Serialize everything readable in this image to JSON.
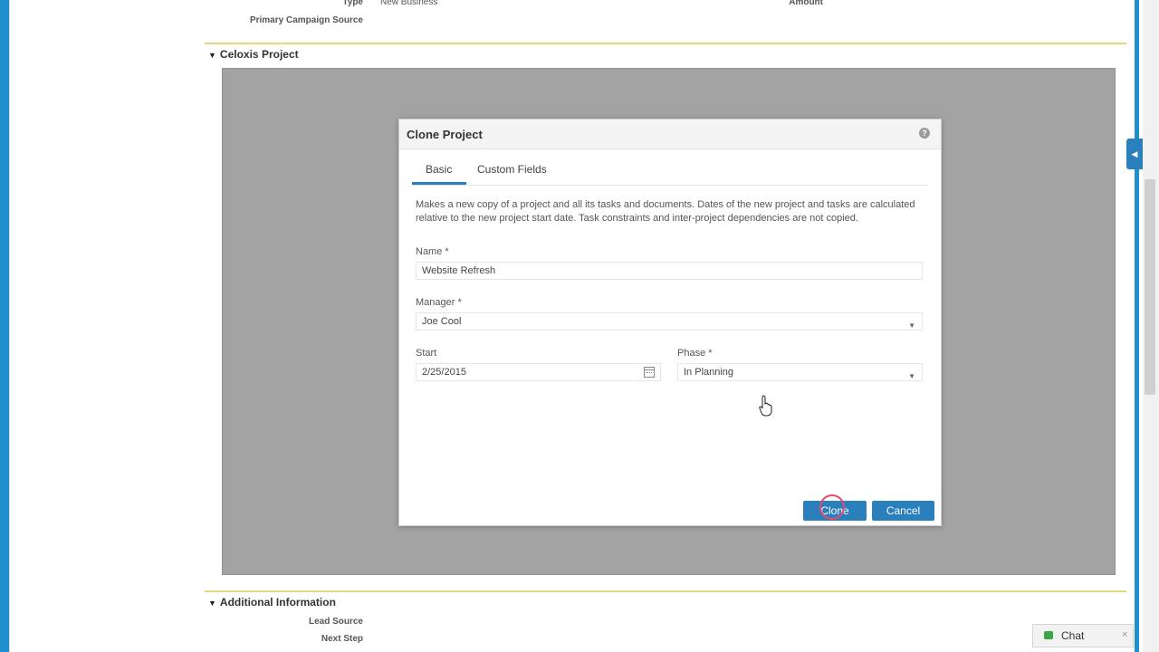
{
  "top_fields": {
    "type_label": "Type",
    "type_value": "New Business",
    "amount_label": "Amount",
    "primary_campaign_label": "Primary Campaign Source"
  },
  "sections": {
    "celoxis_title": "Celoxis Project",
    "additional_title": "Additional Information"
  },
  "additional_fields": {
    "lead_source_label": "Lead Source",
    "next_step_label": "Next Step"
  },
  "dialog": {
    "title": "Clone Project",
    "help_icon": "?",
    "tabs": [
      {
        "label": "Basic",
        "active": true
      },
      {
        "label": "Custom Fields",
        "active": false
      }
    ],
    "description": "Makes a new copy of a project and all its tasks and documents. Dates of the new project and tasks are calculated relative to the new project start date. Task constraints and inter-project dependencies are not copied.",
    "name": {
      "label": "Name",
      "required_mark": "*",
      "value": "Website Refresh"
    },
    "manager": {
      "label": "Manager",
      "required_mark": "*",
      "value": "Joe Cool"
    },
    "start": {
      "label": "Start",
      "value": "2/25/2015"
    },
    "phase": {
      "label": "Phase",
      "required_mark": "*",
      "value": "In Planning"
    },
    "clone_button": "Clone",
    "cancel_button": "Cancel"
  },
  "chat": {
    "label": "Chat",
    "close": "×"
  },
  "icons": {
    "collapse": "triangle-down-icon",
    "select": "chevron-down-icon",
    "calendar": "calendar-icon",
    "chat": "chat-bubble-icon",
    "sidebar_toggle": "triangle-left-icon"
  },
  "colors": {
    "accent": "#2a7fbd",
    "section_rule": "#e8d67c",
    "overlay": "#a3a3a3",
    "click_ring": "#e64a6a"
  }
}
